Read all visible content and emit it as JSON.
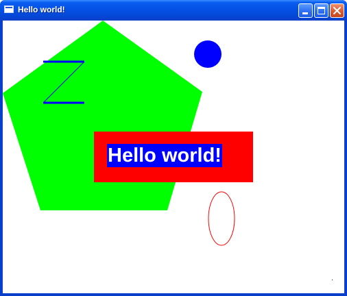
{
  "window": {
    "title": "Hello world!"
  },
  "title_buttons": {
    "minimize_icon": "minimize-icon",
    "maximize_icon": "maximize-icon",
    "close_icon": "close-icon"
  },
  "canvas": {
    "hello_text": "Hello world!",
    "colors": {
      "pentagon": "#00ff00",
      "circle": "#0000ff",
      "zigzag": "#0000ff",
      "text_box": "#ff0000",
      "text_background": "#0000ff",
      "text_color": "#ffffff",
      "ellipse_outline": "#ff0000"
    }
  }
}
